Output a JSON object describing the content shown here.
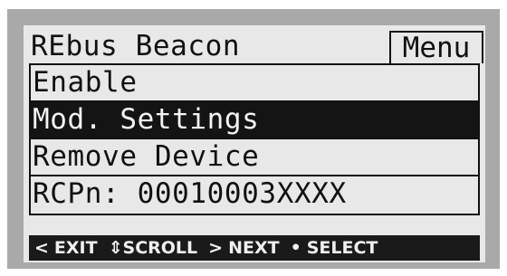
{
  "screen": {
    "title": "REbus Beacon",
    "menu_tab_label": "Menu"
  },
  "menu": {
    "items": [
      {
        "label": "Enable",
        "selected": false
      },
      {
        "label": "Mod. Settings",
        "selected": true
      },
      {
        "label": "Remove Device",
        "selected": false
      },
      {
        "label": "RCPn: 00010003XXXX",
        "selected": false
      }
    ]
  },
  "status_bar": {
    "exit_glyph": "<",
    "exit_label": "EXIT",
    "scroll_glyph": "⇕",
    "scroll_label": "SCROLL",
    "next_glyph": ">",
    "next_label": "NEXT",
    "select_glyph": "•",
    "select_label": "SELECT"
  },
  "colors": {
    "lcd_background": "#e8e8e8",
    "bezel": "#a9a9a9",
    "highlight": "#141414",
    "text": "#111111"
  },
  "icons": {
    "exit": "chevron-left-icon",
    "scroll": "up-down-arrow-icon",
    "next": "chevron-right-icon",
    "select": "dot-icon"
  }
}
